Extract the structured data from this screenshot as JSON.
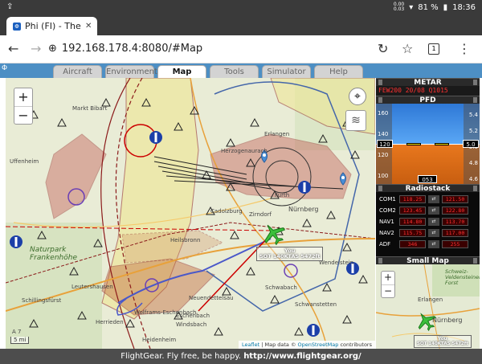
{
  "status_bar": {
    "left_icon": "upload-icon",
    "net_up": "0.00",
    "net_down": "0.03",
    "battery": "81 %",
    "time": "18:36"
  },
  "browser": {
    "tab_title": "Phi (FI) - The F",
    "url": "192.168.178.4:8080/#Map",
    "tab_count": "1"
  },
  "app_nav": {
    "tabs": [
      "Aircraft",
      "Environment",
      "Map",
      "Tools",
      "Simulator",
      "Help"
    ],
    "active": "Map"
  },
  "map": {
    "labels": {
      "markt_bibart": "Markt Bibart",
      "uffenheim": "Uffenheim",
      "erlangen": "Erlangen",
      "herzogenaurach": "Herzogenaurach",
      "cadolzburg": "Cadolzburg",
      "zirndorf": "Zirndorf",
      "nurnberg": "Nürnberg",
      "furth": "Fürth",
      "wendelstein": "Wendelstein",
      "schwabach": "Schwabach",
      "schwanstetten": "Schwanstetten",
      "neuendettelsau": "Neuendettelsau",
      "leutershausen": "Leutershausen",
      "schillingsfurst": "Schillingsfürst",
      "herrieden": "Herrieden",
      "windsbach": "Windsbach",
      "heidenheim": "Heidenheim",
      "eschenbach": "Eschenbach",
      "wolframs": "Wolframs-Eschenbach",
      "heilsbronn": "Heilsbronn",
      "naturpark": "Naturpark\nFrankenhöhe",
      "a7": "A 7"
    },
    "callsign_line1": "You",
    "callsign_line2": "SOT 140KTAS 5472ft",
    "scale": "5 mi",
    "attribution": {
      "leaflet": "Leaflet",
      "sep": "| Map data ©",
      "osm": "OpenStreetMap",
      "suffix": "contributors"
    }
  },
  "metar": {
    "title": "METAR",
    "text": "FEW200 20/08 Q1015"
  },
  "pfd": {
    "title": "PFD",
    "speed_ticks": [
      "160",
      "140",
      "120",
      "100"
    ],
    "speed": "120",
    "alt_ticks": [
      "5.4",
      "5.2",
      "5.0",
      "4.8",
      "4.6"
    ],
    "alt": "5.0",
    "heading": "053"
  },
  "radiostack": {
    "title": "Radiostack",
    "rows": [
      {
        "label": "COM1",
        "active": "118.25",
        "standby": "121.50"
      },
      {
        "label": "COM2",
        "active": "123.45",
        "standby": "122.80"
      },
      {
        "label": "NAV1",
        "active": "114.80",
        "standby": "113.70"
      },
      {
        "label": "NAV2",
        "active": "115.75",
        "standby": "117.00"
      },
      {
        "label": "ADF",
        "active": "346",
        "standby": "255"
      }
    ],
    "swap_label": "⇄"
  },
  "small_map": {
    "title": "Small Map",
    "labels": {
      "erlangen": "Erlangen",
      "nurnberg": "Nürnberg",
      "naturpark": "Schweiz-\nVeldensteiner\nForst"
    },
    "callsign_line1": "You",
    "callsign_line2": "SOT 140KTAS 5472ft"
  },
  "footer": {
    "text": "FlightGear. Fly free, be happy.",
    "link": "http://www.flightgear.org/"
  }
}
